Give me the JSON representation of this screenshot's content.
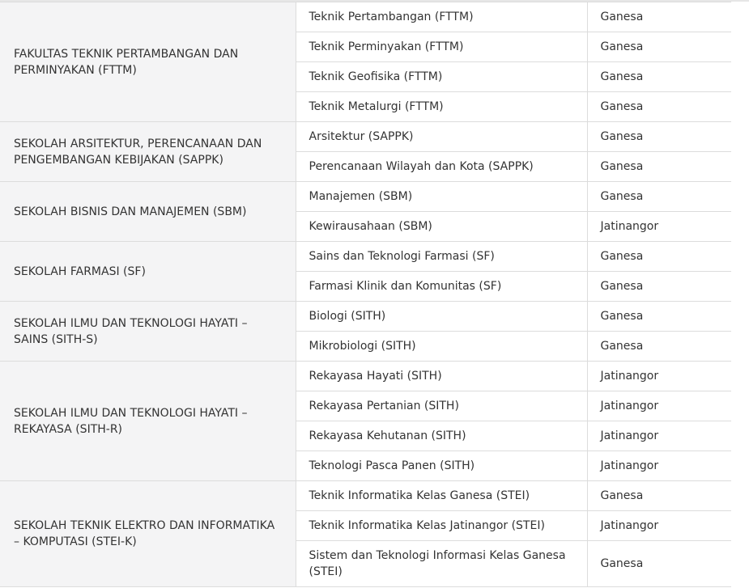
{
  "faculties": [
    {
      "name": "FAKULTAS TEKNIK PERTAMBANGAN DAN PERMINYAKAN (FTTM)",
      "programs": [
        {
          "name": "Teknik Pertambangan (FTTM)",
          "campus": "Ganesa"
        },
        {
          "name": "Teknik Perminyakan (FTTM)",
          "campus": "Ganesa"
        },
        {
          "name": "Teknik Geofisika (FTTM)",
          "campus": "Ganesa"
        },
        {
          "name": "Teknik Metalurgi (FTTM)",
          "campus": "Ganesa"
        }
      ]
    },
    {
      "name": "SEKOLAH ARSITEKTUR, PERENCANAAN DAN PENGEMBANGAN KEBIJAKAN (SAPPK)",
      "programs": [
        {
          "name": "Arsitektur (SAPPK)",
          "campus": "Ganesa"
        },
        {
          "name": "Perencanaan Wilayah dan Kota (SAPPK)",
          "campus": "Ganesa"
        }
      ]
    },
    {
      "name": "SEKOLAH BISNIS DAN MANAJEMEN (SBM)",
      "programs": [
        {
          "name": "Manajemen (SBM)",
          "campus": "Ganesa"
        },
        {
          "name": "Kewirausahaan (SBM)",
          "campus": "Jatinangor"
        }
      ]
    },
    {
      "name": "SEKOLAH FARMASI (SF)",
      "programs": [
        {
          "name": "Sains dan Teknologi Farmasi (SF)",
          "campus": "Ganesa"
        },
        {
          "name": "Farmasi Klinik dan Komunitas (SF)",
          "campus": "Ganesa"
        }
      ]
    },
    {
      "name": "SEKOLAH ILMU DAN TEKNOLOGI HAYATI – SAINS (SITH-S)",
      "programs": [
        {
          "name": "Biologi (SITH)",
          "campus": "Ganesa"
        },
        {
          "name": "Mikrobiologi (SITH)",
          "campus": "Ganesa"
        }
      ]
    },
    {
      "name": "SEKOLAH ILMU DAN TEKNOLOGI HAYATI – REKAYASA (SITH-R)",
      "programs": [
        {
          "name": "Rekayasa Hayati (SITH)",
          "campus": "Jatinangor"
        },
        {
          "name": "Rekayasa Pertanian (SITH)",
          "campus": "Jatinangor"
        },
        {
          "name": "Rekayasa Kehutanan (SITH)",
          "campus": "Jatinangor"
        },
        {
          "name": "Teknologi Pasca Panen (SITH)",
          "campus": "Jatinangor"
        }
      ]
    },
    {
      "name": "SEKOLAH TEKNIK ELEKTRO DAN INFORMATIKA – KOMPUTASI (STEI-K)",
      "programs": [
        {
          "name": "Teknik Informatika Kelas Ganesa (STEI)",
          "campus": "Ganesa"
        },
        {
          "name": "Teknik Informatika Kelas Jatinangor (STEI)",
          "campus": "Jatinangor"
        },
        {
          "name": "Sistem dan Teknologi Informasi Kelas Ganesa (STEI)",
          "campus": "Ganesa"
        }
      ]
    }
  ]
}
